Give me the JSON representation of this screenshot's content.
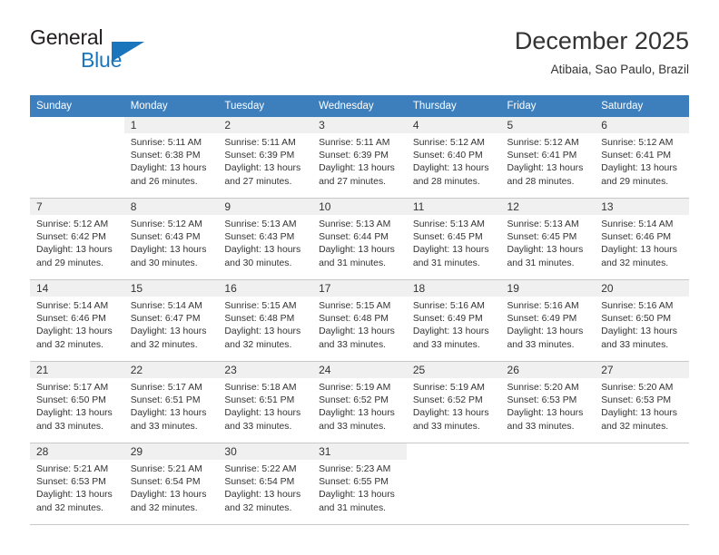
{
  "brand": {
    "name_top": "General",
    "name_bottom": "Blue",
    "accent_color": "#1b75bc",
    "triangle_icon": "triangle-icon"
  },
  "header": {
    "title": "December 2025",
    "subtitle": "Atibaia, Sao Paulo, Brazil"
  },
  "theme": {
    "header_row_bg": "#3d7ebc",
    "daynum_band_bg": "#f0f0f0",
    "grid_line": "#c8c8c8",
    "text": "#333333"
  },
  "columns": [
    "Sunday",
    "Monday",
    "Tuesday",
    "Wednesday",
    "Thursday",
    "Friday",
    "Saturday"
  ],
  "weeks": [
    [
      {
        "day": "",
        "blank": true,
        "sunrise": "",
        "sunset": "",
        "daylight1": "",
        "daylight2": ""
      },
      {
        "day": "1",
        "sunrise": "Sunrise: 5:11 AM",
        "sunset": "Sunset: 6:38 PM",
        "daylight1": "Daylight: 13 hours",
        "daylight2": "and 26 minutes."
      },
      {
        "day": "2",
        "sunrise": "Sunrise: 5:11 AM",
        "sunset": "Sunset: 6:39 PM",
        "daylight1": "Daylight: 13 hours",
        "daylight2": "and 27 minutes."
      },
      {
        "day": "3",
        "sunrise": "Sunrise: 5:11 AM",
        "sunset": "Sunset: 6:39 PM",
        "daylight1": "Daylight: 13 hours",
        "daylight2": "and 27 minutes."
      },
      {
        "day": "4",
        "sunrise": "Sunrise: 5:12 AM",
        "sunset": "Sunset: 6:40 PM",
        "daylight1": "Daylight: 13 hours",
        "daylight2": "and 28 minutes."
      },
      {
        "day": "5",
        "sunrise": "Sunrise: 5:12 AM",
        "sunset": "Sunset: 6:41 PM",
        "daylight1": "Daylight: 13 hours",
        "daylight2": "and 28 minutes."
      },
      {
        "day": "6",
        "sunrise": "Sunrise: 5:12 AM",
        "sunset": "Sunset: 6:41 PM",
        "daylight1": "Daylight: 13 hours",
        "daylight2": "and 29 minutes."
      }
    ],
    [
      {
        "day": "7",
        "sunrise": "Sunrise: 5:12 AM",
        "sunset": "Sunset: 6:42 PM",
        "daylight1": "Daylight: 13 hours",
        "daylight2": "and 29 minutes."
      },
      {
        "day": "8",
        "sunrise": "Sunrise: 5:12 AM",
        "sunset": "Sunset: 6:43 PM",
        "daylight1": "Daylight: 13 hours",
        "daylight2": "and 30 minutes."
      },
      {
        "day": "9",
        "sunrise": "Sunrise: 5:13 AM",
        "sunset": "Sunset: 6:43 PM",
        "daylight1": "Daylight: 13 hours",
        "daylight2": "and 30 minutes."
      },
      {
        "day": "10",
        "sunrise": "Sunrise: 5:13 AM",
        "sunset": "Sunset: 6:44 PM",
        "daylight1": "Daylight: 13 hours",
        "daylight2": "and 31 minutes."
      },
      {
        "day": "11",
        "sunrise": "Sunrise: 5:13 AM",
        "sunset": "Sunset: 6:45 PM",
        "daylight1": "Daylight: 13 hours",
        "daylight2": "and 31 minutes."
      },
      {
        "day": "12",
        "sunrise": "Sunrise: 5:13 AM",
        "sunset": "Sunset: 6:45 PM",
        "daylight1": "Daylight: 13 hours",
        "daylight2": "and 31 minutes."
      },
      {
        "day": "13",
        "sunrise": "Sunrise: 5:14 AM",
        "sunset": "Sunset: 6:46 PM",
        "daylight1": "Daylight: 13 hours",
        "daylight2": "and 32 minutes."
      }
    ],
    [
      {
        "day": "14",
        "sunrise": "Sunrise: 5:14 AM",
        "sunset": "Sunset: 6:46 PM",
        "daylight1": "Daylight: 13 hours",
        "daylight2": "and 32 minutes."
      },
      {
        "day": "15",
        "sunrise": "Sunrise: 5:14 AM",
        "sunset": "Sunset: 6:47 PM",
        "daylight1": "Daylight: 13 hours",
        "daylight2": "and 32 minutes."
      },
      {
        "day": "16",
        "sunrise": "Sunrise: 5:15 AM",
        "sunset": "Sunset: 6:48 PM",
        "daylight1": "Daylight: 13 hours",
        "daylight2": "and 32 minutes."
      },
      {
        "day": "17",
        "sunrise": "Sunrise: 5:15 AM",
        "sunset": "Sunset: 6:48 PM",
        "daylight1": "Daylight: 13 hours",
        "daylight2": "and 33 minutes."
      },
      {
        "day": "18",
        "sunrise": "Sunrise: 5:16 AM",
        "sunset": "Sunset: 6:49 PM",
        "daylight1": "Daylight: 13 hours",
        "daylight2": "and 33 minutes."
      },
      {
        "day": "19",
        "sunrise": "Sunrise: 5:16 AM",
        "sunset": "Sunset: 6:49 PM",
        "daylight1": "Daylight: 13 hours",
        "daylight2": "and 33 minutes."
      },
      {
        "day": "20",
        "sunrise": "Sunrise: 5:16 AM",
        "sunset": "Sunset: 6:50 PM",
        "daylight1": "Daylight: 13 hours",
        "daylight2": "and 33 minutes."
      }
    ],
    [
      {
        "day": "21",
        "sunrise": "Sunrise: 5:17 AM",
        "sunset": "Sunset: 6:50 PM",
        "daylight1": "Daylight: 13 hours",
        "daylight2": "and 33 minutes."
      },
      {
        "day": "22",
        "sunrise": "Sunrise: 5:17 AM",
        "sunset": "Sunset: 6:51 PM",
        "daylight1": "Daylight: 13 hours",
        "daylight2": "and 33 minutes."
      },
      {
        "day": "23",
        "sunrise": "Sunrise: 5:18 AM",
        "sunset": "Sunset: 6:51 PM",
        "daylight1": "Daylight: 13 hours",
        "daylight2": "and 33 minutes."
      },
      {
        "day": "24",
        "sunrise": "Sunrise: 5:19 AM",
        "sunset": "Sunset: 6:52 PM",
        "daylight1": "Daylight: 13 hours",
        "daylight2": "and 33 minutes."
      },
      {
        "day": "25",
        "sunrise": "Sunrise: 5:19 AM",
        "sunset": "Sunset: 6:52 PM",
        "daylight1": "Daylight: 13 hours",
        "daylight2": "and 33 minutes."
      },
      {
        "day": "26",
        "sunrise": "Sunrise: 5:20 AM",
        "sunset": "Sunset: 6:53 PM",
        "daylight1": "Daylight: 13 hours",
        "daylight2": "and 33 minutes."
      },
      {
        "day": "27",
        "sunrise": "Sunrise: 5:20 AM",
        "sunset": "Sunset: 6:53 PM",
        "daylight1": "Daylight: 13 hours",
        "daylight2": "and 32 minutes."
      }
    ],
    [
      {
        "day": "28",
        "sunrise": "Sunrise: 5:21 AM",
        "sunset": "Sunset: 6:53 PM",
        "daylight1": "Daylight: 13 hours",
        "daylight2": "and 32 minutes."
      },
      {
        "day": "29",
        "sunrise": "Sunrise: 5:21 AM",
        "sunset": "Sunset: 6:54 PM",
        "daylight1": "Daylight: 13 hours",
        "daylight2": "and 32 minutes."
      },
      {
        "day": "30",
        "sunrise": "Sunrise: 5:22 AM",
        "sunset": "Sunset: 6:54 PM",
        "daylight1": "Daylight: 13 hours",
        "daylight2": "and 32 minutes."
      },
      {
        "day": "31",
        "sunrise": "Sunrise: 5:23 AM",
        "sunset": "Sunset: 6:55 PM",
        "daylight1": "Daylight: 13 hours",
        "daylight2": "and 31 minutes."
      },
      {
        "day": "",
        "blank": true,
        "sunrise": "",
        "sunset": "",
        "daylight1": "",
        "daylight2": ""
      },
      {
        "day": "",
        "blank": true,
        "sunrise": "",
        "sunset": "",
        "daylight1": "",
        "daylight2": ""
      },
      {
        "day": "",
        "blank": true,
        "sunrise": "",
        "sunset": "",
        "daylight1": "",
        "daylight2": ""
      }
    ]
  ]
}
